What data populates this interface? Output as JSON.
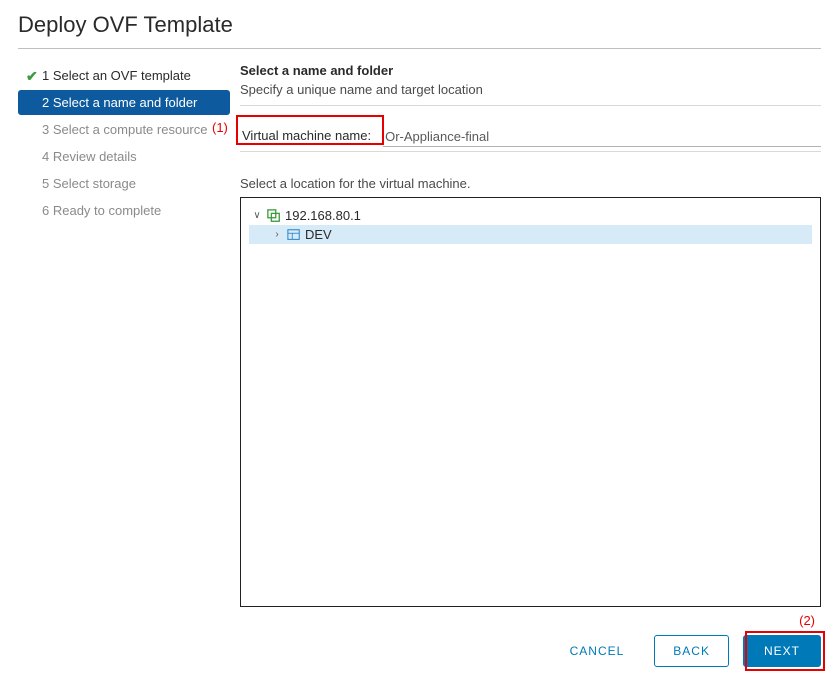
{
  "title": "Deploy OVF Template",
  "sidebar": {
    "steps": [
      {
        "label": "1 Select an OVF template"
      },
      {
        "label": "2 Select a name and folder"
      },
      {
        "label": "3 Select a compute resource"
      },
      {
        "label": "4 Review details"
      },
      {
        "label": "5 Select storage"
      },
      {
        "label": "6 Ready to complete"
      }
    ]
  },
  "main": {
    "section_title": "Select a name and folder",
    "section_subtitle": "Specify a unique name and target location",
    "vm_name_label": "Virtual machine name:",
    "vm_name_value": "Or-Appliance-final",
    "location_label": "Select a location for the virtual machine.",
    "tree": {
      "root": "192.168.80.1",
      "child": "DEV"
    }
  },
  "callouts": {
    "one": "(1)",
    "two": "(2)"
  },
  "footer": {
    "cancel": "CANCEL",
    "back": "BACK",
    "next": "NEXT"
  }
}
